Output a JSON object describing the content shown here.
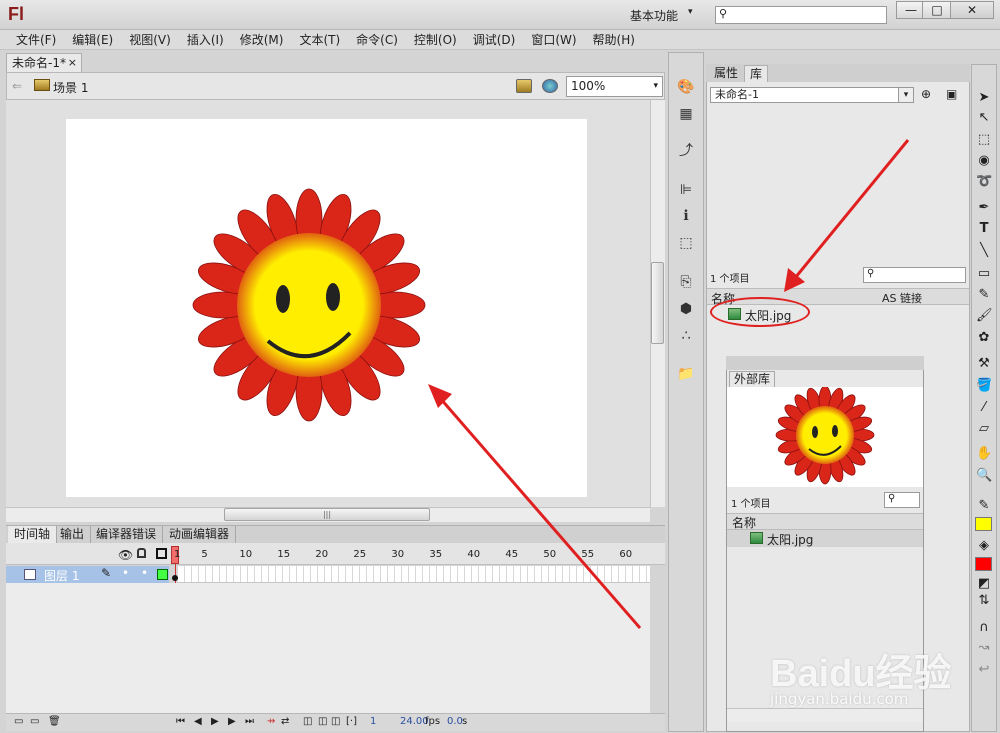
{
  "app": {
    "logo": "Fl",
    "workspace": "基本功能",
    "workspace_arrow": "▾",
    "search_glyph": "⚲"
  },
  "window": {
    "minimize": "—",
    "maximize": "□",
    "close": "✕"
  },
  "menu": [
    "文件(F)",
    "编辑(E)",
    "视图(V)",
    "插入(I)",
    "修改(M)",
    "文本(T)",
    "命令(C)",
    "控制(O)",
    "调试(D)",
    "窗口(W)",
    "帮助(H)"
  ],
  "document": {
    "tab_title": "未命名-1*",
    "tab_close": "×",
    "back_arrow": "⇐",
    "scene": "场景 1",
    "zoom": "100%",
    "zoom_arrow": "▾"
  },
  "stage": {
    "artwork_name": "sunflower-smiley"
  },
  "timeline": {
    "tabs": [
      "时间轴",
      "输出",
      "编译器错误",
      "动画编辑器"
    ],
    "frame_ticks": [
      "1",
      "5",
      "10",
      "15",
      "20",
      "25",
      "30",
      "35",
      "40",
      "45",
      "50",
      "55",
      "60"
    ],
    "layer_name": "图层 1",
    "current_frame": "1",
    "fps": "24.00",
    "fps_unit": "fps",
    "time": "0.0",
    "time_unit": "s"
  },
  "library": {
    "tabs": [
      "属性",
      "库"
    ],
    "document_select": "未命名-1",
    "item_count": "1 个项目",
    "col_name": "名称",
    "col_linkage": "AS 链接",
    "items": [
      "太阳.jpg"
    ]
  },
  "external_library": {
    "tab": "外部库",
    "item_count": "1 个项目",
    "col_name": "名称",
    "items": [
      "太阳.jpg"
    ]
  },
  "colors": {
    "stroke": "#ffff00",
    "fill": "#ff0000",
    "annotation": "#e02020",
    "layer_highlight": "#a6c2e6"
  },
  "watermark": {
    "brand": "Baidu经验",
    "url": "jingyan.baidu.com"
  }
}
